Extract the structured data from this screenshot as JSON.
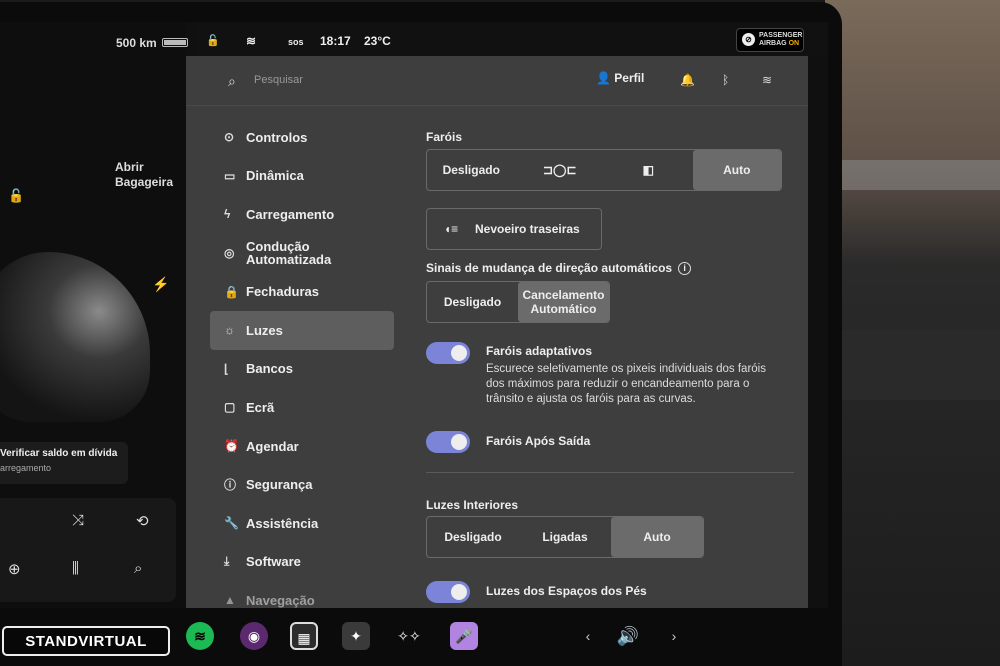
{
  "status_bar": {
    "range": "500 km",
    "sos": "sos",
    "time": "18:17",
    "temperature": "23°C",
    "airbag_line1": "PASSENGER",
    "airbag_line2": "AIRBAG",
    "airbag_state": "ON"
  },
  "left_panel": {
    "trunk_label": "Abrir Bagageira",
    "notice_title": "Verificar saldo em dívida",
    "notice_sub": "arregamento"
  },
  "header": {
    "search_placeholder": "Pesquisar",
    "profile_label": "Perfil"
  },
  "sidebar": {
    "items": [
      {
        "label": "Controlos",
        "icon": "toggle-icon"
      },
      {
        "label": "Dinâmica",
        "icon": "car-icon"
      },
      {
        "label": "Carregamento",
        "icon": "bolt-icon"
      },
      {
        "label": "Condução Automatizada",
        "icon": "steering-wheel-icon"
      },
      {
        "label": "Fechaduras",
        "icon": "lock-icon"
      },
      {
        "label": "Luzes",
        "icon": "sun-icon",
        "active": true
      },
      {
        "label": "Bancos",
        "icon": "seat-icon"
      },
      {
        "label": "Ecrã",
        "icon": "screen-icon"
      },
      {
        "label": "Agendar",
        "icon": "alarm-icon"
      },
      {
        "label": "Segurança",
        "icon": "alert-icon"
      },
      {
        "label": "Assistência",
        "icon": "wrench-icon"
      },
      {
        "label": "Software",
        "icon": "download-icon"
      },
      {
        "label": "Navegação",
        "icon": "navigation-icon"
      }
    ]
  },
  "lights": {
    "headlights_title": "Faróis",
    "headlights_options": [
      "Desligado",
      "",
      "",
      "Auto"
    ],
    "headlights_selected": "Auto",
    "rear_fog_label": "Nevoeiro traseiras",
    "turn_signal_title": "Sinais de mudança de direção automáticos",
    "turn_signal_options": [
      "Desligado",
      "Cancelamento Automático"
    ],
    "turn_signal_selected": "Cancelamento Automático",
    "adaptive_label": "Faróis adaptativos",
    "adaptive_desc": "Escurece seletivamente os pixeis individuais dos faróis dos máximos para reduzir o encandeamento para o trânsito e ajusta os faróis para as curvas.",
    "adaptive_on": true,
    "after_exit_label": "Faróis Após Saída",
    "after_exit_on": true,
    "interior_title": "Luzes Interiores",
    "interior_options": [
      "Desligado",
      "Ligadas",
      "Auto"
    ],
    "interior_selected": "Auto",
    "footwell_label": "Luzes dos Espaços dos Pés",
    "footwell_on": true
  },
  "taskbar": {
    "watermark": "STANDVIRTUAL"
  },
  "colors": {
    "panel_bg": "#3e3e3e",
    "toggle_on": "#7b84d6",
    "selected_segment": "#6b6b6b"
  }
}
